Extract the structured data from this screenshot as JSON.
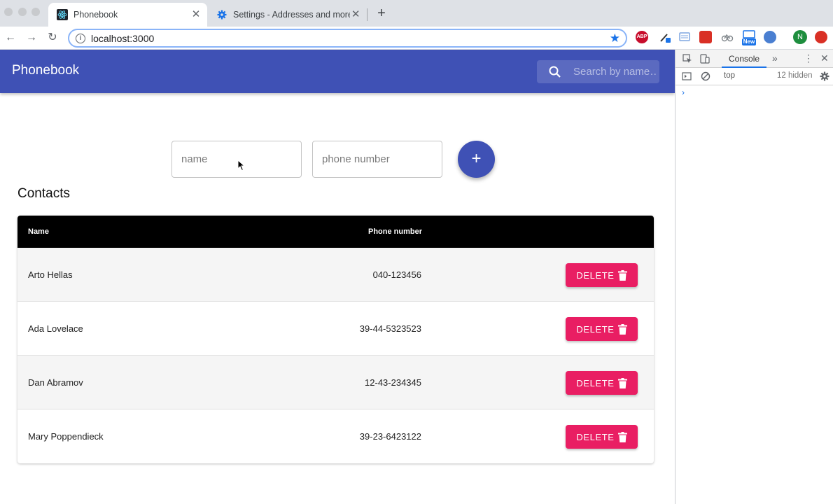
{
  "browser": {
    "tabs": [
      {
        "title": "Phonebook",
        "favicon": "react-icon",
        "active": true
      },
      {
        "title": "Settings - Addresses and more",
        "favicon": "gear-icon",
        "active": false
      }
    ],
    "new_tab_label": "+",
    "url": "localhost:3000",
    "extensions": [
      {
        "name": "abp-icon",
        "text": "ABP",
        "color": "#c70d2c"
      },
      {
        "name": "dropper-icon",
        "text": "",
        "color": "#1a73e8"
      },
      {
        "name": "screen-icon",
        "text": "",
        "color": "#7ea6e0"
      },
      {
        "name": "red-ext-icon",
        "text": "",
        "color": "#d93025"
      },
      {
        "name": "bike-icon",
        "text": "",
        "color": "#9aa0a6"
      },
      {
        "name": "new-ext-icon",
        "text": "New",
        "color": "#1a73e8"
      },
      {
        "name": "blue-ext-icon",
        "text": "",
        "color": "#4a7fd1"
      },
      {
        "name": "profile-avatar",
        "text": "N",
        "color": "#1e8e3e"
      },
      {
        "name": "red-circle-icon",
        "text": "",
        "color": "#d93025"
      }
    ]
  },
  "app": {
    "title": "Phonebook",
    "search_placeholder": "Search by name…",
    "name_placeholder": "name",
    "phone_placeholder": "phone number",
    "add_label": "+",
    "contacts_heading": "Contacts",
    "colors": {
      "primary": "#3f51b5",
      "danger": "#e91e63"
    }
  },
  "table": {
    "headers": {
      "name": "Name",
      "phone": "Phone number"
    },
    "rows": [
      {
        "name": "Arto Hellas",
        "phone": "040-123456",
        "action": "DELETE"
      },
      {
        "name": "Ada Lovelace",
        "phone": "39-44-5323523",
        "action": "DELETE"
      },
      {
        "name": "Dan Abramov",
        "phone": "12-43-234345",
        "action": "DELETE"
      },
      {
        "name": "Mary Poppendieck",
        "phone": "39-23-6423122",
        "action": "DELETE"
      }
    ]
  },
  "devtools": {
    "tab": "Console",
    "context": "top",
    "hidden": "12 hidden",
    "prompt": "›"
  }
}
